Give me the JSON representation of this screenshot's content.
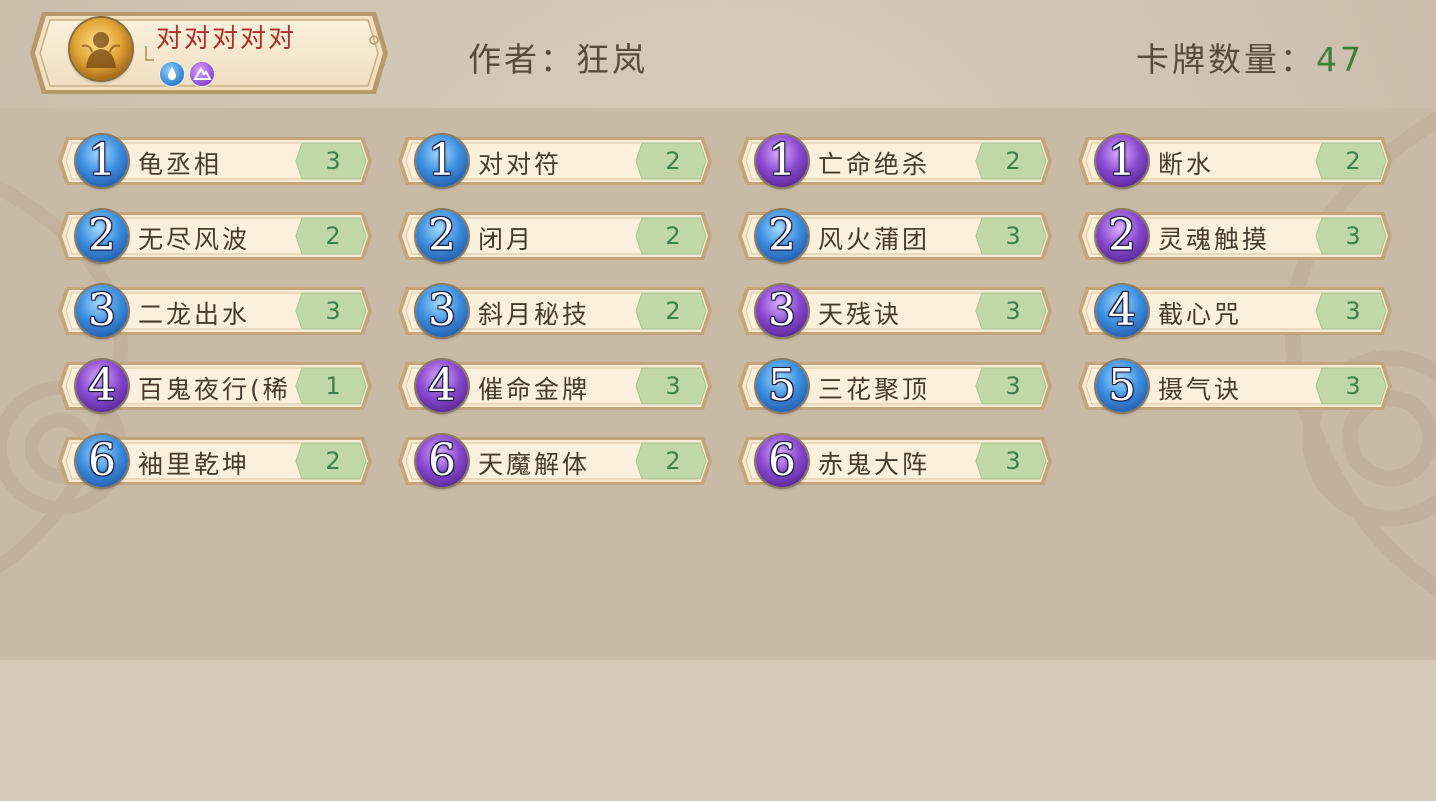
{
  "header": {
    "deck_name": "对对对对对",
    "author_text": "作者：狂岚",
    "count_label": "卡牌数量：",
    "count_value": "47",
    "element_icons": [
      "water-drop-icon",
      "mountain-icon"
    ]
  },
  "colors": {
    "deck_name": "#b0302e",
    "count_value": "#3c7f3a",
    "qty_badge": "#bfd8a6",
    "cost_blue": "#3d8fe0",
    "cost_purple": "#8a4ad0"
  },
  "cards": [
    {
      "cost": "1",
      "name": "龟丞相",
      "qty": "3",
      "gem": "blue"
    },
    {
      "cost": "1",
      "name": "对对符",
      "qty": "2",
      "gem": "blue"
    },
    {
      "cost": "1",
      "name": "亡命绝杀",
      "qty": "2",
      "gem": "purple"
    },
    {
      "cost": "1",
      "name": "断水",
      "qty": "2",
      "gem": "purple"
    },
    {
      "cost": "2",
      "name": "无尽风波",
      "qty": "2",
      "gem": "blue"
    },
    {
      "cost": "2",
      "name": "闭月",
      "qty": "2",
      "gem": "blue"
    },
    {
      "cost": "2",
      "name": "风火蒲团",
      "qty": "3",
      "gem": "blue"
    },
    {
      "cost": "2",
      "name": "灵魂触摸",
      "qty": "3",
      "gem": "purple"
    },
    {
      "cost": "3",
      "name": "二龙出水",
      "qty": "3",
      "gem": "blue"
    },
    {
      "cost": "3",
      "name": "斜月秘技",
      "qty": "2",
      "gem": "blue"
    },
    {
      "cost": "3",
      "name": "天残诀",
      "qty": "3",
      "gem": "purple"
    },
    {
      "cost": "4",
      "name": "截心咒",
      "qty": "3",
      "gem": "blue"
    },
    {
      "cost": "4",
      "name": "百鬼夜行(稀",
      "qty": "1",
      "gem": "purple"
    },
    {
      "cost": "4",
      "name": "催命金牌",
      "qty": "3",
      "gem": "purple"
    },
    {
      "cost": "5",
      "name": "三花聚顶",
      "qty": "3",
      "gem": "blue"
    },
    {
      "cost": "5",
      "name": "摄气诀",
      "qty": "3",
      "gem": "blue"
    },
    {
      "cost": "6",
      "name": "袖里乾坤",
      "qty": "2",
      "gem": "blue"
    },
    {
      "cost": "6",
      "name": "天魔解体",
      "qty": "2",
      "gem": "purple"
    },
    {
      "cost": "6",
      "name": "赤鬼大阵",
      "qty": "3",
      "gem": "purple"
    }
  ]
}
